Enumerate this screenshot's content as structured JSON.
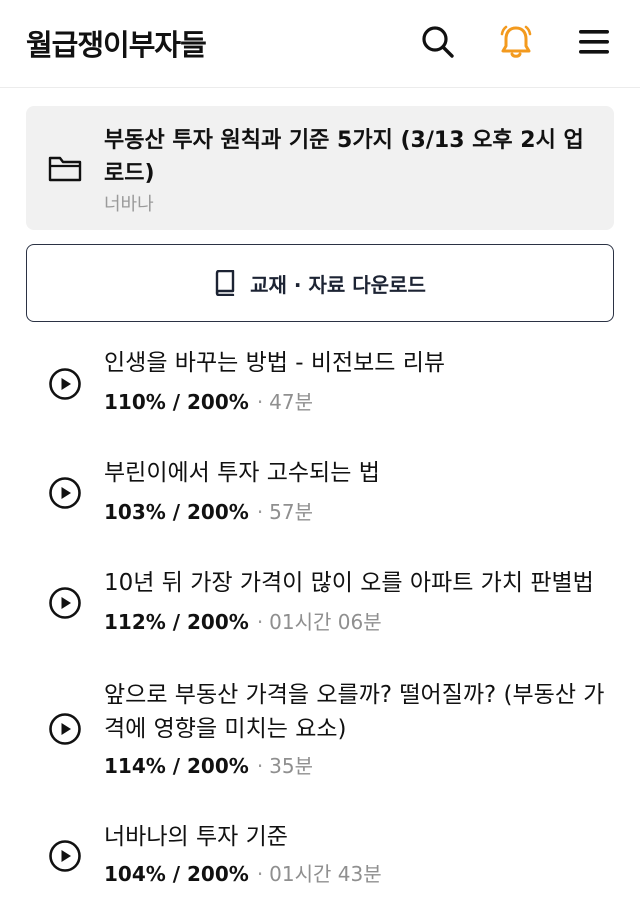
{
  "header": {
    "brand": "월급쟁이부자들",
    "icons": [
      "search-icon",
      "bell-icon",
      "menu-icon"
    ],
    "bell_color": "#f39a1e"
  },
  "course": {
    "title": "부동산 투자 원칙과 기준 5가지 (3/13 오후 2시 업로드)",
    "author": "너바나",
    "icon": "folder-icon",
    "card_bg": "#f1f1f1"
  },
  "download": {
    "label": "교재 · 자료 다운로드",
    "icon": "book-icon"
  },
  "lessons": [
    {
      "title": "인생을 바꾸는 방법 - 비전보드 리뷰",
      "progress": "110% / 200%",
      "duration": "47분"
    },
    {
      "title": "부린이에서 투자 고수되는 법",
      "progress": "103% / 200%",
      "duration": "57분"
    },
    {
      "title": "10년 뒤 가장 가격이 많이 오를 아파트 가치 판별법",
      "progress": "112% / 200%",
      "duration": "01시간 06분"
    },
    {
      "title": "앞으로 부동산 가격을 오를까? 떨어질까? (부동산 가격에 영향을 미치는 요소)",
      "progress": "114% / 200%",
      "duration": "35분"
    },
    {
      "title": "너바나의 투자 기준",
      "progress": "104% / 200%",
      "duration": "01시간 43분"
    }
  ]
}
